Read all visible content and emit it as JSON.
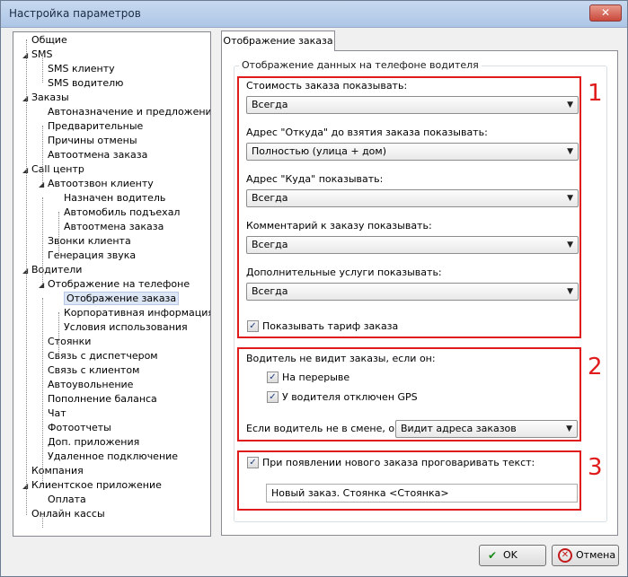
{
  "window": {
    "title": "Настройка параметров",
    "close_glyph": "✕"
  },
  "tree": {
    "items": [
      {
        "label": "Общие",
        "level": 0,
        "expander": ""
      },
      {
        "label": "SMS",
        "level": 0,
        "expander": "◢"
      },
      {
        "label": "SMS клиенту",
        "level": 1,
        "expander": ""
      },
      {
        "label": "SMS водителю",
        "level": 1,
        "expander": ""
      },
      {
        "label": "Заказы",
        "level": 0,
        "expander": "◢"
      },
      {
        "label": "Автоназначение и предложение",
        "level": 1,
        "expander": ""
      },
      {
        "label": "Предварительные",
        "level": 1,
        "expander": ""
      },
      {
        "label": "Причины отмены",
        "level": 1,
        "expander": ""
      },
      {
        "label": "Автоотмена заказа",
        "level": 1,
        "expander": ""
      },
      {
        "label": "Call центр",
        "level": 0,
        "expander": "◢"
      },
      {
        "label": "Автоотзвон клиенту",
        "level": 1,
        "expander": "◢"
      },
      {
        "label": "Назначен водитель",
        "level": 2,
        "expander": ""
      },
      {
        "label": "Автомобиль подъехал",
        "level": 2,
        "expander": ""
      },
      {
        "label": "Автоотмена заказа",
        "level": 2,
        "expander": ""
      },
      {
        "label": "Звонки клиента",
        "level": 1,
        "expander": ""
      },
      {
        "label": "Генерация звука",
        "level": 1,
        "expander": ""
      },
      {
        "label": "Водители",
        "level": 0,
        "expander": "◢"
      },
      {
        "label": "Отображение на телефоне",
        "level": 1,
        "expander": "◢"
      },
      {
        "label": "Отображение заказа",
        "level": 2,
        "expander": "",
        "selected": true
      },
      {
        "label": "Корпоративная информация",
        "level": 2,
        "expander": ""
      },
      {
        "label": "Условия использования",
        "level": 2,
        "expander": ""
      },
      {
        "label": "Стоянки",
        "level": 1,
        "expander": ""
      },
      {
        "label": "Связь с диспетчером",
        "level": 1,
        "expander": ""
      },
      {
        "label": "Связь с клиентом",
        "level": 1,
        "expander": ""
      },
      {
        "label": "Автоувольнение",
        "level": 1,
        "expander": ""
      },
      {
        "label": "Пополнение баланса",
        "level": 1,
        "expander": ""
      },
      {
        "label": "Чат",
        "level": 1,
        "expander": ""
      },
      {
        "label": "Фотоотчеты",
        "level": 1,
        "expander": ""
      },
      {
        "label": "Доп. приложения",
        "level": 1,
        "expander": ""
      },
      {
        "label": "Удаленное подключение",
        "level": 1,
        "expander": ""
      },
      {
        "label": "Компания",
        "level": 0,
        "expander": ""
      },
      {
        "label": "Клиентское приложение",
        "level": 0,
        "expander": "◢"
      },
      {
        "label": "Оплата",
        "level": 1,
        "expander": ""
      },
      {
        "label": "Онлайн кассы",
        "level": 0,
        "expander": ""
      }
    ]
  },
  "tab": {
    "label": "Отображение заказа"
  },
  "group": {
    "caption": "Отображение данных на телефоне водителя"
  },
  "section1": {
    "number": "1",
    "fields": [
      {
        "label": "Стоимость заказа показывать:",
        "value": "Всегда"
      },
      {
        "label": "Адрес \"Откуда\" до взятия заказа показывать:",
        "value": "Полностью (улица + дом)"
      },
      {
        "label": "Адрес \"Куда\" показывать:",
        "value": "Всегда"
      },
      {
        "label": "Комментарий к заказу показывать:",
        "value": "Всегда"
      },
      {
        "label": "Дополнительные услуги показывать:",
        "value": "Всегда"
      }
    ],
    "show_tariff": {
      "label": "Показывать тариф заказа",
      "checked": true
    }
  },
  "section2": {
    "number": "2",
    "heading": "Водитель не видит заказы, если он:",
    "on_break": {
      "label": "На перерыве",
      "checked": true
    },
    "gps_off": {
      "label": "У водителя отключен GPS",
      "checked": true
    },
    "not_in_shift_label": "Если водитель не в смене, он:",
    "not_in_shift_value": "Видит адреса заказов"
  },
  "section3": {
    "number": "3",
    "announce": {
      "label": "При появлении нового заказа проговаривать текст:",
      "checked": true
    },
    "announce_text": "Новый заказ. Стоянка <Стоянка>"
  },
  "buttons": {
    "ok_label": "OK",
    "ok_icon": "✔",
    "cancel_label": "Отмена",
    "cancel_icon": "✕"
  },
  "icons": {
    "dropdown_arrow": "▼",
    "check_mark": "✓"
  },
  "colors": {
    "annotation_red": "#e01b1b",
    "selection": "#dde6f4"
  }
}
